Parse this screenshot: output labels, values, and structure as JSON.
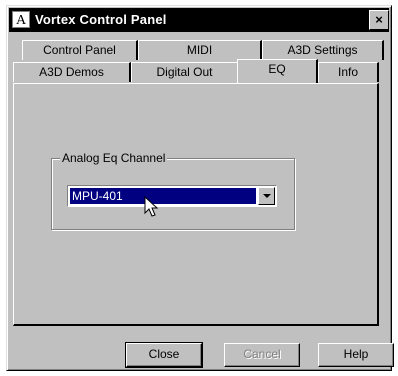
{
  "window": {
    "title": "Vortex Control Panel",
    "app_icon_glyph": "A",
    "close_glyph": "×"
  },
  "tabs": {
    "row_back": [
      {
        "label": "Control Panel"
      },
      {
        "label": "MIDI"
      },
      {
        "label": "A3D Settings"
      }
    ],
    "row_front": [
      {
        "label": "A3D Demos"
      },
      {
        "label": "Digital Out"
      },
      {
        "label": "EQ",
        "active": true
      },
      {
        "label": "Info"
      }
    ]
  },
  "eq_panel": {
    "group_label": "Analog Eq Channel",
    "combo": {
      "selected_value": "MPU-401",
      "arrow_icon": "chevron-down-icon"
    }
  },
  "buttons": {
    "close": "Close",
    "cancel": "Cancel",
    "help": "Help"
  },
  "colors": {
    "titlebar": "#000000",
    "face": "#c0c0c0",
    "selection": "#000080"
  }
}
